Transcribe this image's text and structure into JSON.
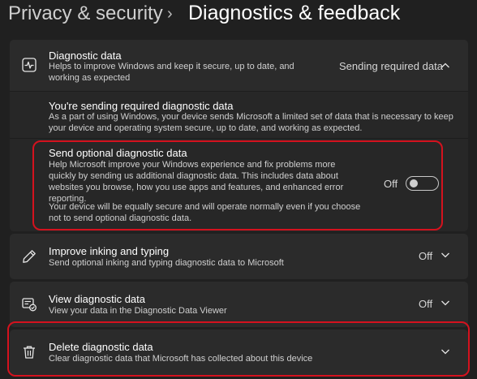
{
  "breadcrumb": {
    "parent": "Privacy & security",
    "separator": "›",
    "current": "Diagnostics & feedback"
  },
  "diagnostic_data": {
    "icon": "pulse-icon",
    "title": "Diagnostic data",
    "description": "Helps to improve Windows and keep it secure, up to date, and working as expected",
    "status": "Sending required data",
    "expanded": true,
    "required": {
      "title": "You're sending required diagnostic data",
      "description": "As a part of using Windows, your device sends Microsoft a limited set of data that is necessary to keep your device and operating system secure, up to date, and working as expected."
    },
    "optional": {
      "title": "Send optional diagnostic data",
      "description": "Help Microsoft improve your Windows experience and fix problems more quickly by sending us additional diagnostic data. This includes data about websites you browse, how you use apps and features, and enhanced error reporting.",
      "note": "Your device will be equally secure and will operate normally even if you choose not to send optional diagnostic data.",
      "toggle_label": "Off",
      "toggle_on": false
    }
  },
  "inking": {
    "icon": "pen-icon",
    "title": "Improve inking and typing",
    "description": "Send optional inking and typing diagnostic data to Microsoft",
    "status": "Off"
  },
  "view_data": {
    "icon": "diagnostic-viewer-icon",
    "title": "View diagnostic data",
    "description": "View your data in the Diagnostic Data Viewer",
    "status": "Off"
  },
  "delete_data": {
    "icon": "trash-icon",
    "title": "Delete diagnostic data",
    "description": "Clear diagnostic data that Microsoft has collected about this device"
  },
  "colors": {
    "highlight": "#d4121e",
    "background": "#202020",
    "card": "#2b2b2b"
  }
}
